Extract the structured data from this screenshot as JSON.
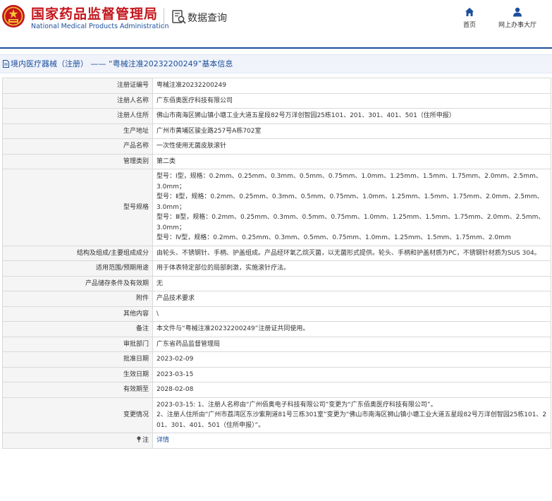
{
  "header": {
    "site_title_cn": "国家药品监督管理局",
    "site_title_en": "National Medical Products Administration",
    "query_label": "数据查询",
    "nav": [
      {
        "label": "首页",
        "icon": "home-icon"
      },
      {
        "label": "网上办事大厅",
        "icon": "user-icon"
      }
    ]
  },
  "subheader": {
    "title": "境内医疗器械（注册） —— “粤械注准20232200249”基本信息"
  },
  "colors": {
    "brand_red": "#c3161c",
    "brand_blue": "#1c4f9c"
  },
  "rows": [
    {
      "label": "注册证编号",
      "value": "粤械注准20232200249"
    },
    {
      "label": "注册人名称",
      "value": "广东佰奥医疗科技有限公司"
    },
    {
      "label": "注册人住所",
      "value": "佛山市南海区狮山镇小塘工业大道五星段82号万洋创智园25栋101、201、301、401、501（住所申报）"
    },
    {
      "label": "生产地址",
      "value": "广州市黄埔区骏业路257号A栋702室"
    },
    {
      "label": "产品名称",
      "value": "一次性使用无菌皮肤滚针"
    },
    {
      "label": "管理类别",
      "value": "第二类"
    },
    {
      "label": "型号规格",
      "lines": [
        "型号：Ⅰ型，规格：0.2mm、0.25mm、0.3mm、0.5mm、0.75mm、1.0mm、1.25mm、1.5mm、1.75mm、2.0mm、2.5mm、3.0mm；",
        "型号：Ⅱ型，规格：0.2mm、0.25mm、0.3mm、0.5mm、0.75mm、1.0mm、1.25mm、1.5mm、1.75mm、2.0mm、2.5mm、3.0mm；",
        "型号：Ⅲ型，规格：0.2mm、0.25mm、0.3mm、0.5mm、0.75mm、1.0mm、1.25mm、1.5mm、1.75mm、2.0mm、2.5mm、3.0mm；",
        "型号：Ⅳ型，规格：0.2mm、0.25mm、0.3mm、0.5mm、0.75mm、1.0mm、1.25mm、1.5mm、1.75mm、2.0mm"
      ]
    },
    {
      "label": "结构及组成/主要组成成分",
      "value": "由轮头、不锈钢针、手柄、护盖组成。产品经环氧乙烷灭菌，以无菌形式提供。轮头、手柄和护盖材质为PC，不锈钢针材质为SUS 304。"
    },
    {
      "label": "适用范围/预期用途",
      "value": "用于体表特定部位的局部刺激，实施滚针疗法。"
    },
    {
      "label": "产品储存条件及有效期",
      "value": "无"
    },
    {
      "label": "附件",
      "value": "产品技术要求"
    },
    {
      "label": "其他内容",
      "value": "\\"
    },
    {
      "label": "备注",
      "value": "本文件与“粤械注准20232200249”注册证共同使用。"
    },
    {
      "label": "审批部门",
      "value": "广东省药品监督管理局"
    },
    {
      "label": "批准日期",
      "value": "2023-02-09"
    },
    {
      "label": "生效日期",
      "value": "2023-03-15"
    },
    {
      "label": "有效期至",
      "value": "2028-02-08"
    },
    {
      "label": "变更情况",
      "lines": [
        "2023-03-15: 1、注册人名称由“广州佰奥电子科技有限公司”变更为“广东佰奥医疗科技有限公司”。",
        "2、注册人住所由“广州市荔湾区东沙紫荆道81号三栋301室”变更为“佛山市南海区狮山镇小塘工业大道五星段82号万洋创智园25栋101、201、301、401、501（住所申报）”。"
      ]
    },
    {
      "label": "注",
      "icon": "pin-icon",
      "value": "详情",
      "link": true
    }
  ]
}
